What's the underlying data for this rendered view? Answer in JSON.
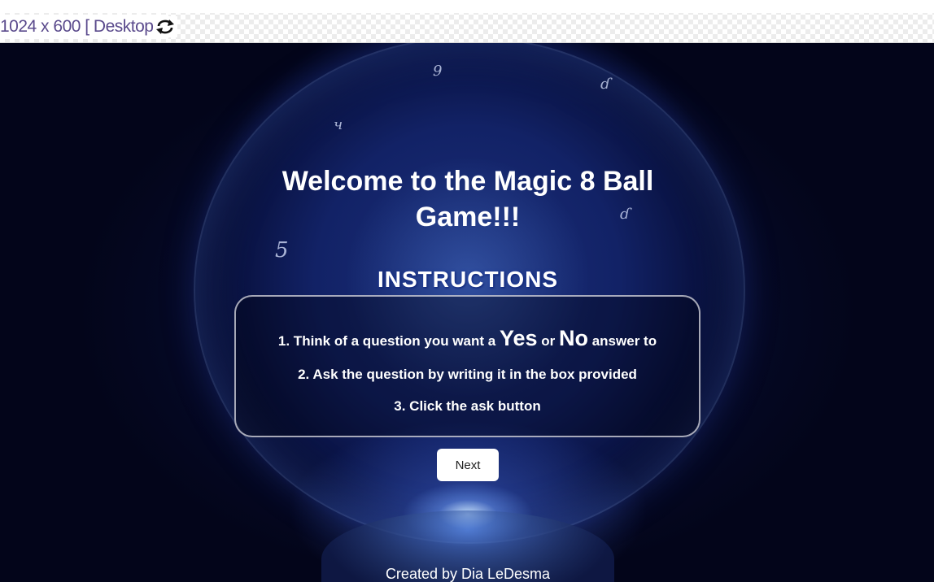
{
  "viewer": {
    "viewport_label": "1024 x 600 [ Desktop ]",
    "rotate_icon": "rotate-icon"
  },
  "game": {
    "title": "Welcome to the Magic 8 Ball Game!!!",
    "instructions_heading": "INSTRUCTIONS",
    "step1_prefix": "1. Think of a question you want a",
    "step1_yes": "Yes",
    "step1_or": "or",
    "step1_no": "No",
    "step1_suffix": "answer to",
    "step2": "2. Ask the question by writing it in the box provided",
    "step3": "3. Click the ask button",
    "next_label": "Next",
    "credit": "Created by Dia LeDesma"
  },
  "colors": {
    "accent_purple": "#5a4a8c",
    "background_navy": "#0b1548",
    "text": "#ffffff"
  }
}
